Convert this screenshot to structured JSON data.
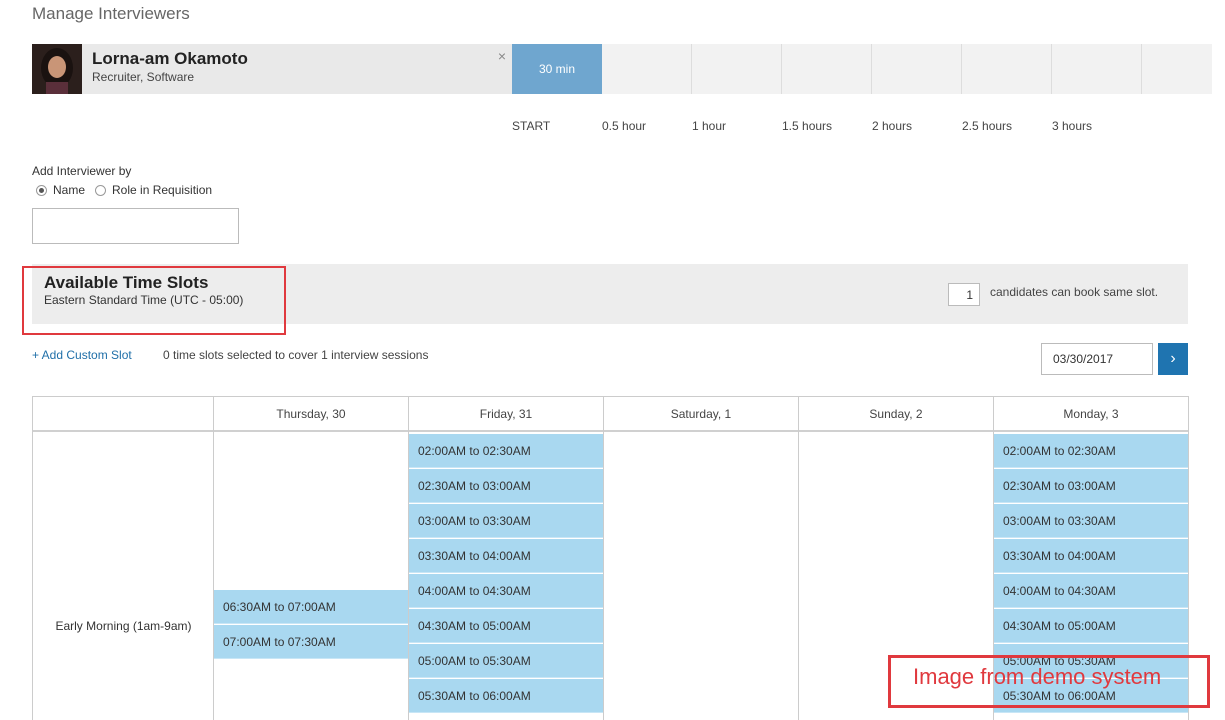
{
  "page": {
    "title": "Manage Interviewers"
  },
  "interviewer": {
    "name": "Lorna-am Okamoto",
    "role": "Recruiter, Software",
    "close": "×",
    "block_label": "30 min"
  },
  "timeline": {
    "labels": [
      "START",
      "0.5 hour",
      "1 hour",
      "1.5 hours",
      "2 hours",
      "2.5 hours",
      "3 hours"
    ]
  },
  "add_interviewer": {
    "label": "Add Interviewer by",
    "options": [
      "Name",
      "Role in Requisition"
    ],
    "selected": "Name",
    "input_value": ""
  },
  "available": {
    "title": "Available Time Slots",
    "timezone": "Eastern Standard Time (UTC - 05:00)",
    "candidates_value": "1",
    "candidates_text": "candidates can book same slot."
  },
  "toolbar": {
    "add_custom": "+ Add Custom Slot",
    "selected_info": "0 time slots selected to cover 1 interview sessions",
    "date_value": "03/30/2017",
    "next_icon": "›"
  },
  "calendar": {
    "columns": [
      "Thursday, 30",
      "Friday, 31",
      "Saturday, 1",
      "Sunday, 2",
      "Monday, 3"
    ],
    "row_label": "Early Morning (1am-9am)",
    "thursday_slots": [
      "06:30AM to 07:00AM",
      "07:00AM to 07:30AM"
    ],
    "friday_slots": [
      "02:00AM to 02:30AM",
      "02:30AM to 03:00AM",
      "03:00AM to 03:30AM",
      "03:30AM to 04:00AM",
      "04:00AM to 04:30AM",
      "04:30AM to 05:00AM",
      "05:00AM to 05:30AM",
      "05:30AM to 06:00AM"
    ],
    "monday_slots": [
      "02:00AM to 02:30AM",
      "02:30AM to 03:00AM",
      "03:00AM to 03:30AM",
      "03:30AM to 04:00AM",
      "04:00AM to 04:30AM",
      "04:30AM to 05:00AM",
      "05:00AM to 05:30AM",
      "05:30AM to 06:00AM"
    ]
  },
  "watermark": "Image from demo system",
  "colors": {
    "accent": "#1f74b0",
    "slot": "#a9d8f0",
    "annotation": "#e0393e"
  }
}
